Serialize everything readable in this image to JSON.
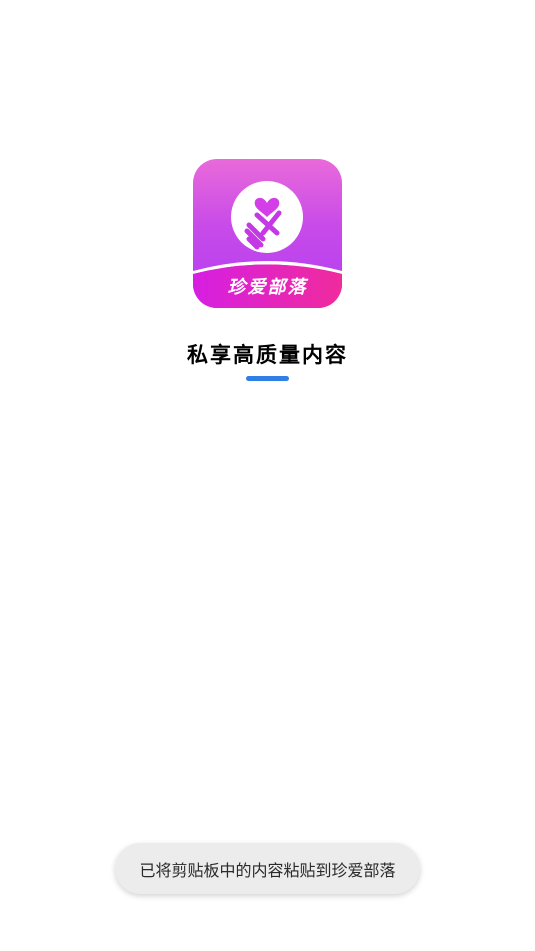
{
  "app": {
    "icon_name": "heart-finger-icon",
    "banner_text": "珍爱部落",
    "colors": {
      "gradient_top": "#e96ad9",
      "gradient_bottom": "#b13cf2",
      "banner": "#e11fd3",
      "heart": "#d43ee8"
    }
  },
  "splash": {
    "slogan": "私享高质量内容",
    "underline_color": "#2f7fe6"
  },
  "toast": {
    "message": "已将剪贴板中的内容粘贴到珍爱部落"
  }
}
